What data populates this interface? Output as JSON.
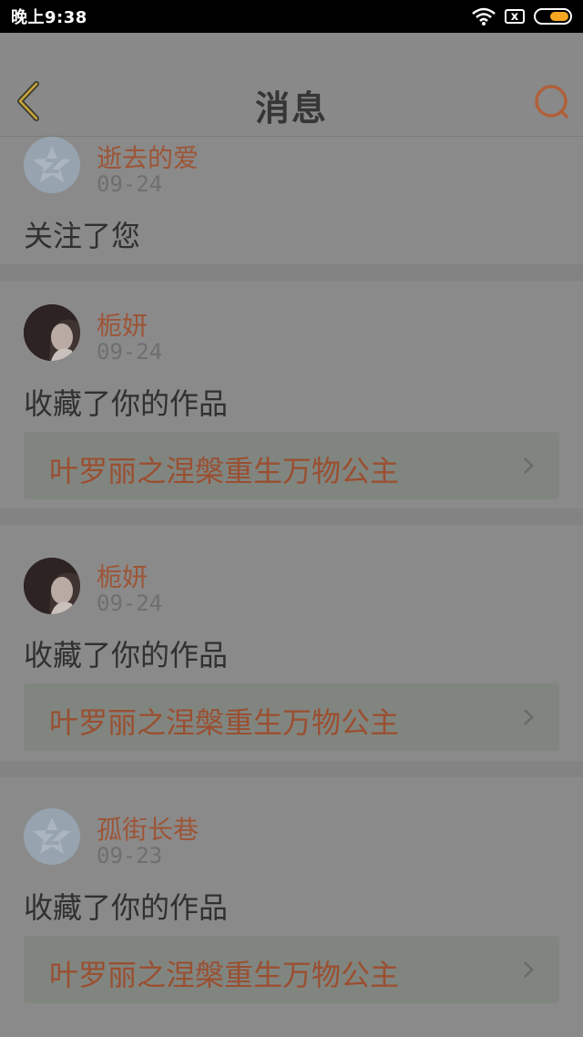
{
  "status_bar": {
    "time": "晚上9:38",
    "sim_label": "x",
    "battery_level": 0.6
  },
  "header": {
    "title": "消息"
  },
  "messages": [
    {
      "user": "逝去的爱",
      "date": "09-24",
      "action": "关注了您",
      "avatar": "default-qq-avatar",
      "work_title": null
    },
    {
      "user": "栀妍",
      "date": "09-24",
      "action": "收藏了你的作品",
      "avatar": "user-photo",
      "work_title": "叶罗丽之涅槃重生万物公主"
    },
    {
      "user": "栀妍",
      "date": "09-24",
      "action": "收藏了你的作品",
      "avatar": "user-photo",
      "work_title": "叶罗丽之涅槃重生万物公主"
    },
    {
      "user": "孤街长巷",
      "date": "09-23",
      "action": "收藏了你的作品",
      "avatar": "default-qq-avatar",
      "work_title": "叶罗丽之涅槃重生万物公主"
    }
  ],
  "colors": {
    "accent": "#9d5537",
    "overlay_bg": "#8a8a8a",
    "battery": "#f5a623"
  }
}
